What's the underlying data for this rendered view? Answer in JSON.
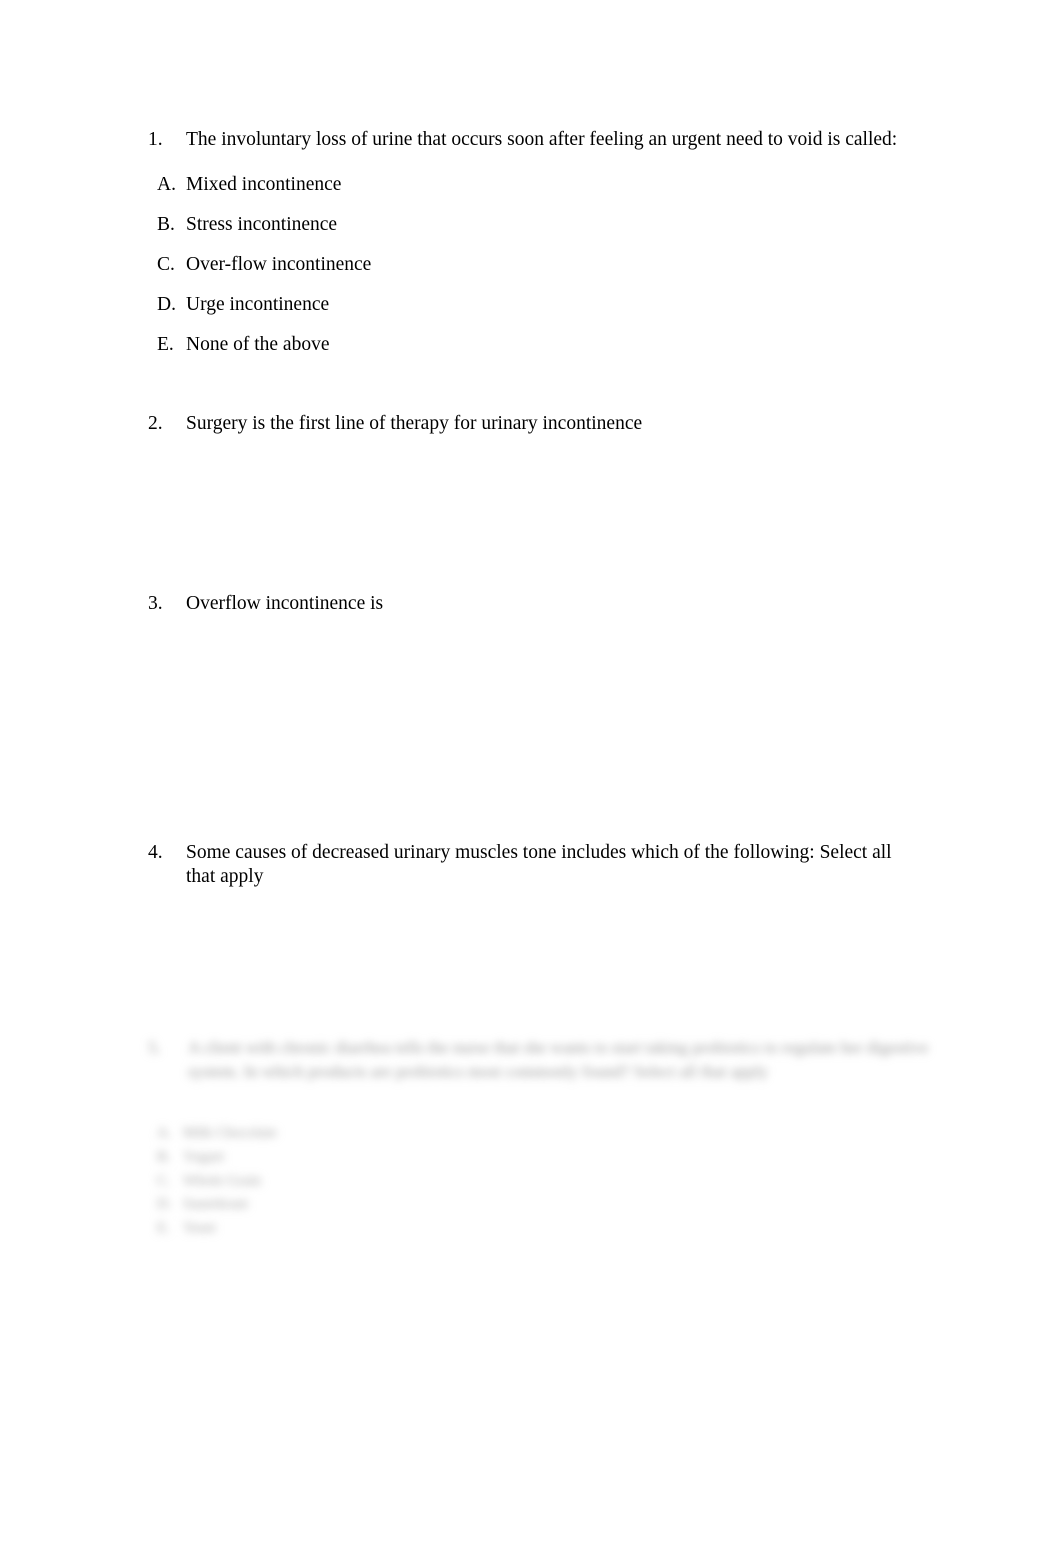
{
  "document": {
    "background_color": "#ffffff",
    "text_color": "#000000",
    "blurred_text_color": "#9a9a9a"
  },
  "questions": [
    {
      "number": "1.",
      "text": "The involuntary loss of urine that occurs soon after feeling an urgent need to void is called:",
      "options": [
        {
          "letter": "A.",
          "text": "Mixed incontinence"
        },
        {
          "letter": "B.",
          "text": "Stress incontinence"
        },
        {
          "letter": "C.",
          "text": "Over-flow incontinence"
        },
        {
          "letter": "D.",
          "text": "Urge incontinence"
        },
        {
          "letter": "E.",
          "text": "None of the above"
        }
      ]
    },
    {
      "number": "2.",
      "text": "Surgery is the first line of therapy for urinary incontinence",
      "options": []
    },
    {
      "number": "3.",
      "text": "Overflow incontinence is",
      "options": []
    },
    {
      "number": "4.",
      "text": "Some causes of decreased urinary muscles tone includes which of the following:  Select all that apply",
      "options": []
    },
    {
      "number": "5.",
      "text": "A client with chronic diarrhea tells the nurse that she wants to start taking probiotics to regulate her digestive system. In which products are probiotics most commonly found? Select all that apply",
      "illegible": true,
      "options": [
        {
          "letter": "A.",
          "text": "Milk Chocolate",
          "illegible": true
        },
        {
          "letter": "B.",
          "text": "Yogurt",
          "illegible": true
        },
        {
          "letter": "C.",
          "text": "Whole Grain",
          "illegible": true
        },
        {
          "letter": "D.",
          "text": "Sauerkraut",
          "illegible": true
        },
        {
          "letter": "E.",
          "text": "Yeast",
          "illegible": true
        }
      ]
    }
  ]
}
